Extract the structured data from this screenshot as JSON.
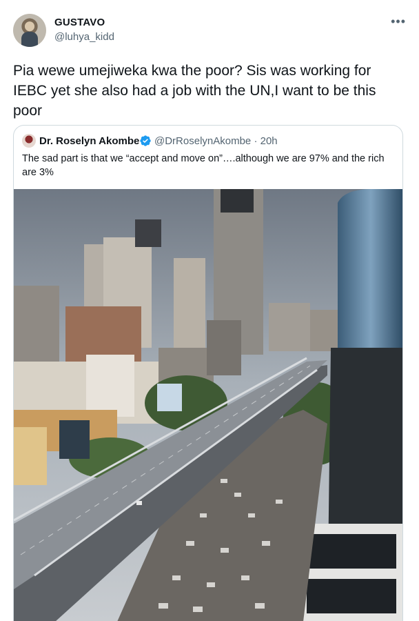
{
  "tweet": {
    "display_name": "GUSTAVO",
    "handle": "@luhya_kidd",
    "more_icon": "more-horizontal-icon",
    "text": "Pia wewe umejiweka kwa the poor? Sis was working for IEBC yet she also had a job with the UN,I want to be this poor"
  },
  "quote": {
    "display_name": "Dr. Roselyn Akombe",
    "verified_icon": "verified-badge-icon",
    "handle_time": "@DrRoselynAkombe · 20h",
    "text": "The sad part is that we “accept and move on”….although we are 97% and the rich are 3%",
    "image_subject": "city-skyline-with-empty-expressway-and-traffic-jam"
  },
  "colors": {
    "text": "#0f1419",
    "secondary": "#536471",
    "border": "#cfd9de",
    "verified": "#1d9bf0"
  }
}
